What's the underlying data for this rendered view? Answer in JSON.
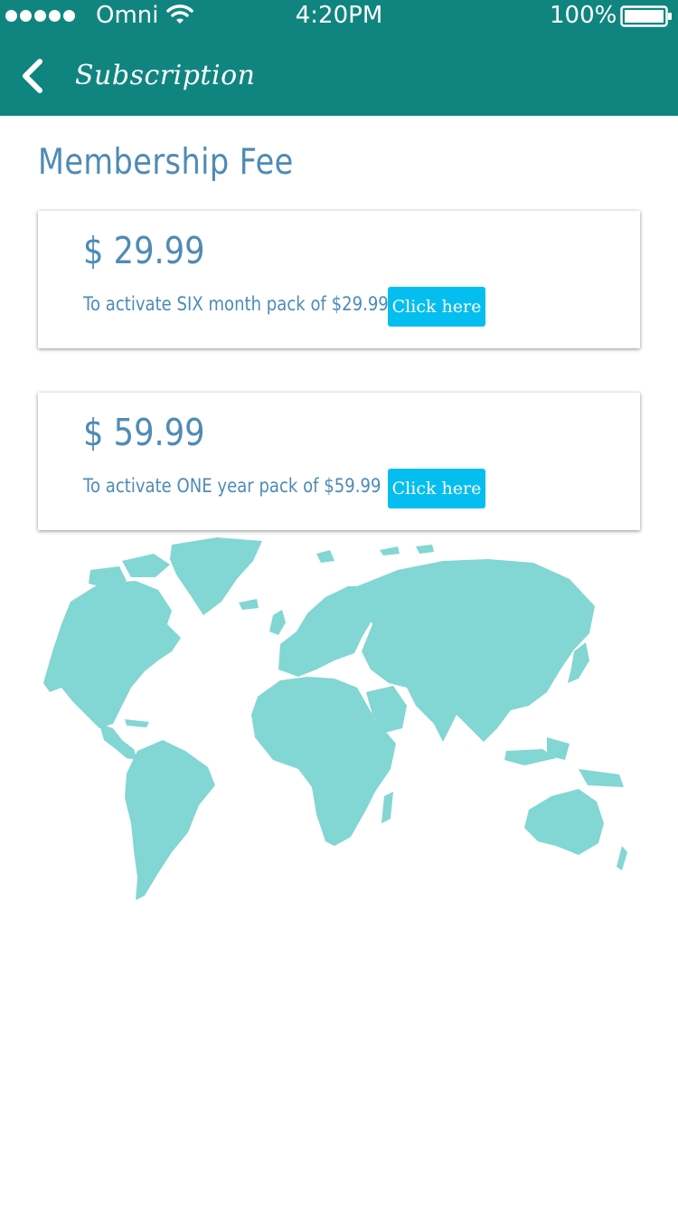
{
  "status_bar": {
    "carrier": "Omni",
    "time": "4:20PM",
    "battery": "100%"
  },
  "header": {
    "title": "Subscription"
  },
  "main": {
    "section_title": "Membership Fee",
    "plans": [
      {
        "price": "$ 29.99",
        "description": "To activate SIX month pack of $29.99",
        "button_label": "Click here"
      },
      {
        "price": "$ 59.99",
        "description": "To activate ONE year pack of $59.99",
        "button_label": "Click here"
      }
    ]
  },
  "colors": {
    "header_bg": "#108580",
    "accent_text": "#4e8bb6",
    "button_bg": "#05bef0",
    "map_fill": "#82d6d3"
  },
  "icons": [
    "signal-dots-icon",
    "wifi-icon",
    "battery-icon",
    "back-chevron-icon",
    "world-map"
  ]
}
